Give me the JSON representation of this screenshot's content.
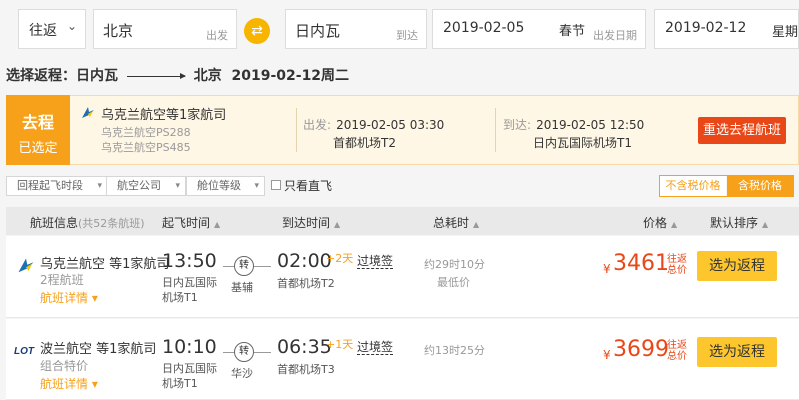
{
  "search": {
    "trip_type": "往返",
    "from_city": "北京",
    "from_hint": "出发",
    "to_city": "日内瓦",
    "to_hint": "到达",
    "depart_date": "2019-02-05",
    "depart_holiday": "春节",
    "depart_hint": "出发日期",
    "return_date": "2019-02-12",
    "return_week": "星期"
  },
  "route": {
    "prefix": "选择返程：",
    "origin": "日内瓦",
    "dest": "北京",
    "date": "2019-02-12周二"
  },
  "selected": {
    "tag_title": "去程",
    "tag_sub": "已选定",
    "airline": "乌克兰航空等1家航司",
    "flight1": "乌克兰航空PS288",
    "flight2": "乌克兰航空PS485",
    "dep_label": "出发:",
    "dep_time": "2019-02-05 03:30",
    "dep_airport": "首都机场T2",
    "arr_label": "到达:",
    "arr_time": "2019-02-05 12:50",
    "arr_airport": "日内瓦国际机场T1",
    "rebook": "重选去程航班"
  },
  "filters": {
    "depart_time": "回程起飞时段",
    "airline": "航空公司",
    "cabin": "舱位等级",
    "direct_only": "只看直飞",
    "no_tax": "不含税价格",
    "with_tax": "含税价格"
  },
  "table": {
    "flight_info": "航班信息",
    "flight_count": "(共52条航班)",
    "dep_time": "起飞时间",
    "arr_time": "到达时间",
    "duration": "总耗时",
    "price": "价格",
    "sort": "默认排序"
  },
  "flights": [
    {
      "airline": "乌克兰航空 等1家航司",
      "sub": "2程航班",
      "detail": "航班详情",
      "dep_time": "13:50",
      "dep_airport": "日内瓦国际机场T1",
      "transfer": "转",
      "transfer_city": "基辅",
      "arr_time": "02:00",
      "arr_plus": "+2天",
      "arr_airport": "首都机场T2",
      "transit": "过境签",
      "duration": "约29时10分",
      "duration_note": "最低价",
      "currency": "¥",
      "price": "3461",
      "price_note": "往返总价",
      "select": "选为返程"
    },
    {
      "airline": "波兰航空 等1家航司",
      "sub": "组合特价",
      "detail": "航班详情",
      "dep_time": "10:10",
      "dep_airport": "日内瓦国际机场T1",
      "transfer": "转",
      "transfer_city": "华沙",
      "arr_time": "06:35",
      "arr_plus": "+1天",
      "arr_airport": "首都机场T3",
      "transit": "过境签",
      "duration": "约13时25分",
      "duration_note": "",
      "currency": "¥",
      "price": "3699",
      "price_note": "往返总价",
      "select": "选为返程"
    }
  ],
  "colors": {
    "accent": "#f7a11a",
    "price": "#e94717",
    "button": "#fec62d"
  }
}
